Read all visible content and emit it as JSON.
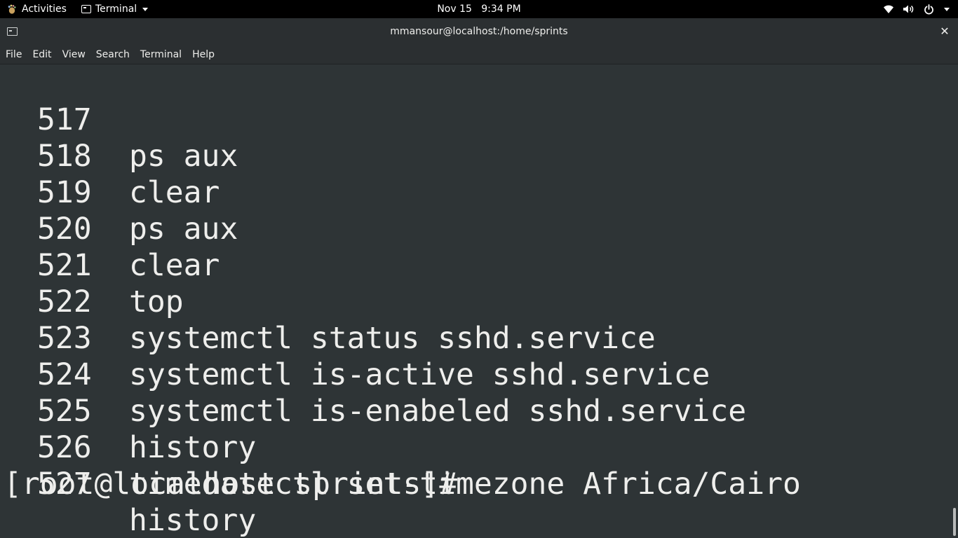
{
  "topbar": {
    "activities_label": "Activities",
    "app_label": "Terminal",
    "clock": "Nov 15   9:34 PM",
    "status_icons": [
      "wifi-icon",
      "volume-icon",
      "power-icon"
    ]
  },
  "window": {
    "title": "mmansour@localhost:/home/sprints",
    "close_glyph": "✕"
  },
  "menubar": {
    "items": [
      "File",
      "Edit",
      "View",
      "Search",
      "Terminal",
      "Help"
    ]
  },
  "terminal": {
    "history": [
      {
        "num": "517",
        "cmd": "ps aux"
      },
      {
        "num": "518",
        "cmd": "clear"
      },
      {
        "num": "519",
        "cmd": "ps aux"
      },
      {
        "num": "520",
        "cmd": "clear"
      },
      {
        "num": "521",
        "cmd": "top"
      },
      {
        "num": "522",
        "cmd": "systemctl status sshd.service"
      },
      {
        "num": "523",
        "cmd": "systemctl is-active sshd.service"
      },
      {
        "num": "524",
        "cmd": "systemctl is-enabeled sshd.service"
      },
      {
        "num": "525",
        "cmd": "history"
      },
      {
        "num": "526",
        "cmd": "timedatectl set-timezone Africa/Cairo"
      },
      {
        "num": "527",
        "cmd": "history"
      }
    ],
    "prompt": "[root@localhost sprints]#"
  },
  "colors": {
    "terminal_bg": "#2e3436",
    "terminal_fg": "#eeeeec",
    "topbar_bg": "#000000",
    "header_bg": "#2b2f31"
  }
}
